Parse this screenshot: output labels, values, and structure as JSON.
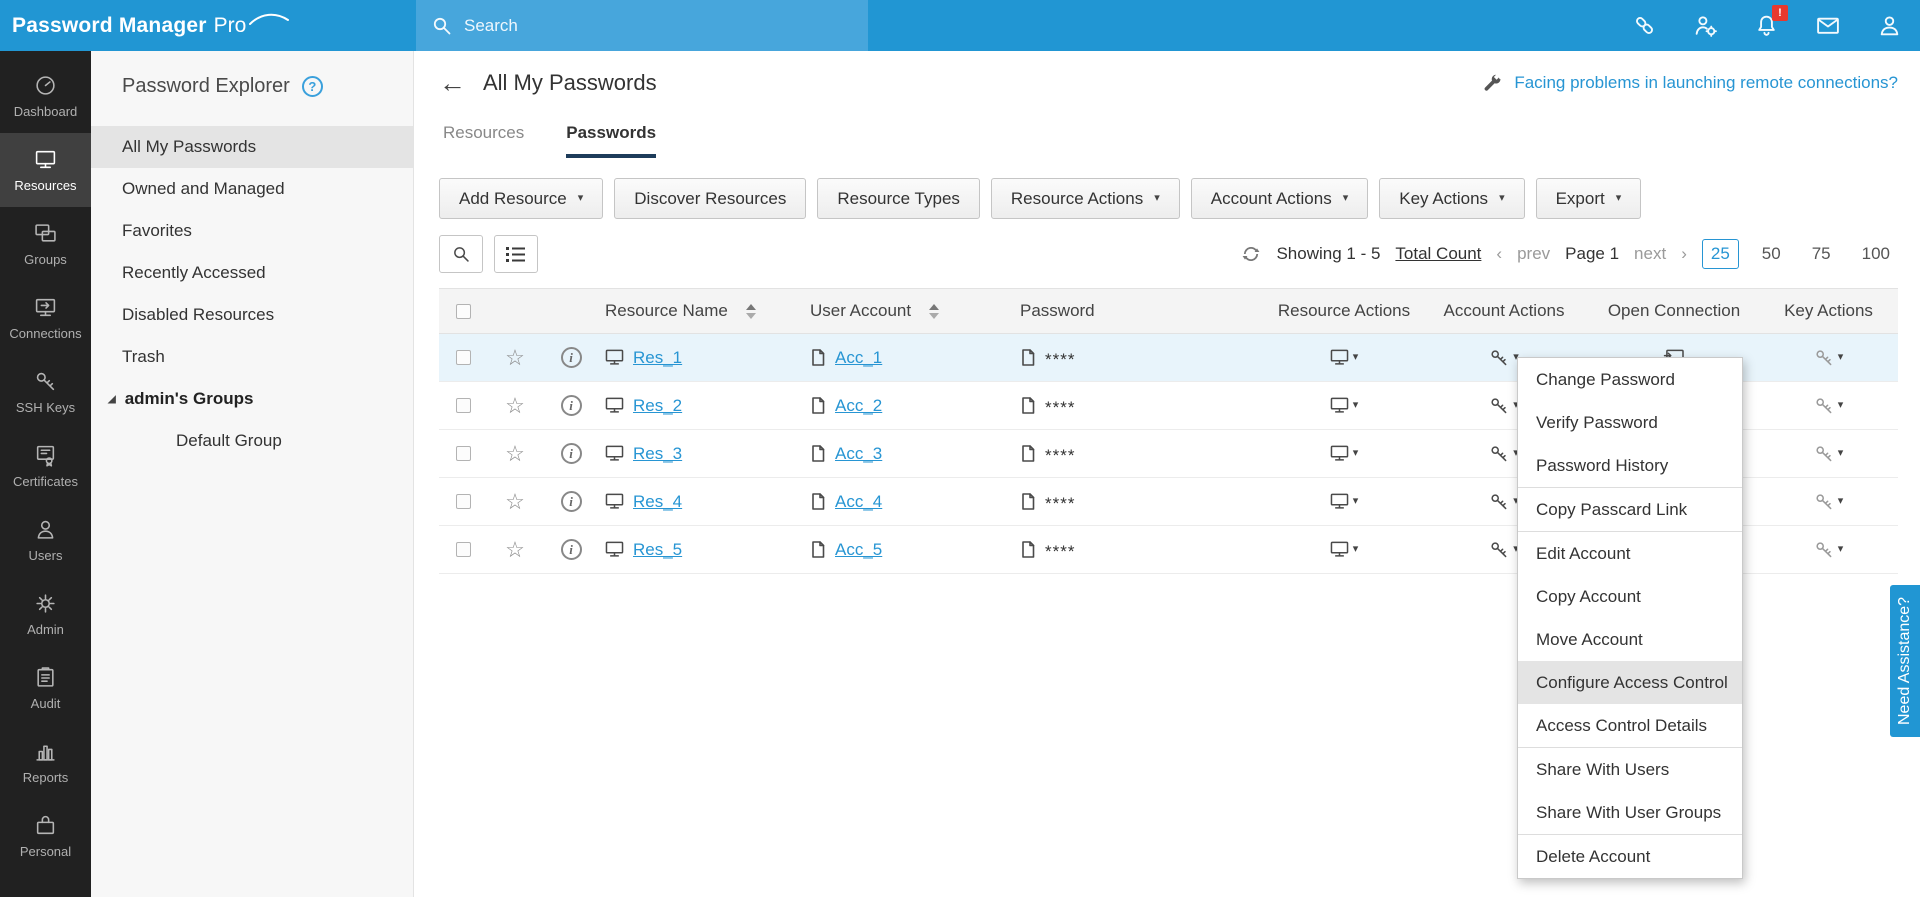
{
  "app": {
    "logo_main": "Password Manager",
    "logo_pro": "Pro",
    "search_placeholder": "Search"
  },
  "sidebar": {
    "active": "Resources",
    "items": [
      {
        "label": "Dashboard"
      },
      {
        "label": "Resources"
      },
      {
        "label": "Groups"
      },
      {
        "label": "Connections"
      },
      {
        "label": "SSH Keys"
      },
      {
        "label": "Certificates"
      },
      {
        "label": "Users"
      },
      {
        "label": "Admin"
      },
      {
        "label": "Audit"
      },
      {
        "label": "Reports"
      },
      {
        "label": "Personal"
      }
    ]
  },
  "explorer": {
    "title": "Password Explorer",
    "items": [
      {
        "label": "All My Passwords",
        "selected": true
      },
      {
        "label": "Owned and Managed"
      },
      {
        "label": "Favorites"
      },
      {
        "label": "Recently Accessed"
      },
      {
        "label": "Disabled Resources"
      },
      {
        "label": "Trash"
      }
    ],
    "group_label": "admin's Groups",
    "group_child": "Default Group"
  },
  "main": {
    "page_title": "All My Passwords",
    "remote_help": "Facing problems in launching remote connections?",
    "tabs": [
      {
        "label": "Resources"
      },
      {
        "label": "Passwords",
        "active": true
      }
    ],
    "toolbar": [
      {
        "label": "Add Resource",
        "dropdown": true
      },
      {
        "label": "Discover Resources",
        "dropdown": false
      },
      {
        "label": "Resource Types",
        "dropdown": false
      },
      {
        "label": "Resource Actions",
        "dropdown": true
      },
      {
        "label": "Account Actions",
        "dropdown": true
      },
      {
        "label": "Key Actions",
        "dropdown": true
      },
      {
        "label": "Export",
        "dropdown": true
      }
    ],
    "pagination": {
      "showing": "Showing 1 - 5",
      "total_count": "Total Count",
      "prev": "prev",
      "page": "Page 1",
      "next": "next",
      "sizes": [
        "25",
        "50",
        "75",
        "100"
      ],
      "active_size": "25"
    }
  },
  "table": {
    "headers": {
      "resource": "Resource Name",
      "account": "User Account",
      "password": "Password",
      "resource_actions": "Resource Actions",
      "account_actions": "Account Actions",
      "open_connection": "Open Connection",
      "key_actions": "Key Actions"
    },
    "rows": [
      {
        "resource": "Res_1",
        "account": "Acc_1",
        "password": "****"
      },
      {
        "resource": "Res_2",
        "account": "Acc_2",
        "password": "****"
      },
      {
        "resource": "Res_3",
        "account": "Acc_3",
        "password": "****"
      },
      {
        "resource": "Res_4",
        "account": "Acc_4",
        "password": "****"
      },
      {
        "resource": "Res_5",
        "account": "Acc_5",
        "password": "****"
      }
    ]
  },
  "context_menu": {
    "highlighted": "Configure Access Control",
    "groups": [
      {
        "items": [
          "Change Password",
          "Verify Password",
          "Password History"
        ]
      },
      {
        "items": [
          "Copy Passcard Link"
        ]
      },
      {
        "items": [
          "Edit Account",
          "Copy Account",
          "Move Account",
          "Configure Access Control",
          "Access Control Details"
        ]
      },
      {
        "items": [
          "Share With Users",
          "Share With User Groups"
        ]
      },
      {
        "items": [
          "Delete Account"
        ]
      }
    ]
  },
  "assist": {
    "label": "Need Assistance?"
  },
  "icons": {
    "caret": "▾",
    "star": "☆",
    "back": "←",
    "help": "?",
    "info": "i",
    "tree_expanded": "◢",
    "prev_chevron": "‹",
    "next_chevron": "›",
    "bell_badge": "!"
  },
  "colors": {
    "topbar": "#2196d3",
    "topbar_search": "#47a6dc",
    "accent_blue": "#2795d3",
    "active_tab_underline": "#1d3c5a",
    "selected_row": "#e8f4fb",
    "sidebar_bg": "#212121"
  }
}
